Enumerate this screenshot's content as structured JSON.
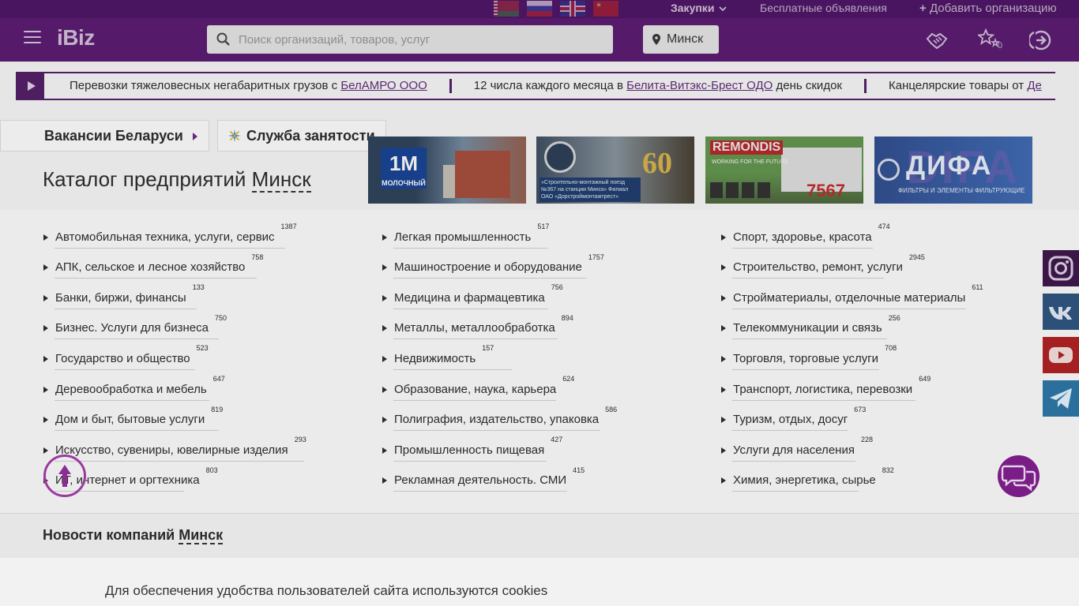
{
  "topbar": {
    "flags": [
      "by-flag",
      "ru-flag",
      "gb-flag",
      "cn-flag"
    ],
    "purchases": "Закупки",
    "free_ads": "Бесплатные объявления",
    "add_org": "Добавить организацию"
  },
  "header": {
    "logo": "iBiz",
    "search_placeholder": "Поиск организаций, товаров, услуг",
    "city": "Минск",
    "favorites_count": "0"
  },
  "ticker": {
    "items": [
      {
        "pre": "Перевозки тяжеловесных негабаритных грузов с ",
        "link": "БелАМРО ООО",
        "post": ""
      },
      {
        "pre": "12 числа каждого месяца в ",
        "link": "Белита-Витэкс-Брест ОДО",
        "post": " день скидок"
      },
      {
        "pre": "Канцелярские товары от ",
        "link": "Де",
        "post": ""
      }
    ]
  },
  "tabs": {
    "vacancies": "Вакансии Беларуси",
    "employment": "Служба занятости"
  },
  "catalog": {
    "title_prefix": "Каталог предприятий ",
    "title_city": "Минск",
    "columns": [
      [
        {
          "label": "Автомобильная техника, услуги, сервис",
          "count": "1387"
        },
        {
          "label": "АПК, сельское и лесное хозяйство",
          "count": "758"
        },
        {
          "label": "Банки, биржи, финансы",
          "count": "133"
        },
        {
          "label": "Бизнес. Услуги для бизнеса",
          "count": "750"
        },
        {
          "label": "Государство и общество",
          "count": "523"
        },
        {
          "label": "Деревообработка и мебель",
          "count": "647"
        },
        {
          "label": "Дом и быт, бытовые услуги",
          "count": "819"
        },
        {
          "label": "Искусство, сувениры, ювелирные изделия",
          "count": "293"
        },
        {
          "label": "ИТ, интернет и оргтехника",
          "count": "803"
        }
      ],
      [
        {
          "label": "Легкая промышленность",
          "count": "517"
        },
        {
          "label": "Машиностроение и оборудование",
          "count": "1757"
        },
        {
          "label": "Медицина и фармацевтика",
          "count": "756"
        },
        {
          "label": "Металлы, металлообработка",
          "count": "894"
        },
        {
          "label": "Недвижимость",
          "count": "157"
        },
        {
          "label": "Образование, наука, карьера",
          "count": "624"
        },
        {
          "label": "Полиграфия, издательство, упаковка",
          "count": "586"
        },
        {
          "label": "Промышленность пищевая",
          "count": "427"
        },
        {
          "label": "Рекламная деятельность. СМИ",
          "count": "415"
        }
      ],
      [
        {
          "label": "Спорт, здоровье, красота",
          "count": "474"
        },
        {
          "label": "Строительство, ремонт, услуги",
          "count": "2945"
        },
        {
          "label": "Стройматериалы, отделочные материалы",
          "count": "611"
        },
        {
          "label": "Телекоммуникации и связь",
          "count": "256"
        },
        {
          "label": "Торговля, торговые услуги",
          "count": "708"
        },
        {
          "label": "Транспорт, логистика, перевозки",
          "count": "649"
        },
        {
          "label": "Туризм, отдых, досуг",
          "count": "673"
        },
        {
          "label": "Услуги для населения",
          "count": "228"
        },
        {
          "label": "Химия, энергетика, сырье",
          "count": "832"
        }
      ]
    ]
  },
  "banners": {
    "b1_logo": "1M",
    "b1_sub": "МОЛОЧНЫЙ",
    "b2_text": "«Строительно-монтажный поезд №367 на станции Минск» Филиал ОАО «Дорстроймонтажтрест»",
    "b2_big": "60",
    "b3_title": "REMONDIS",
    "b3_sub": "WORKING FOR THE FUTURE",
    "b3_num": "7567",
    "b4_bg": "DIFA",
    "b4_title": "ДИФА",
    "b4_sub": "ФИЛЬТРЫ И ЭЛЕМЕНТЫ ФИЛЬТРУЮЩИЕ"
  },
  "news": {
    "title_prefix": "Новости компаний ",
    "title_city": "Минск"
  },
  "cookie": {
    "text": "Для обеспечения удобства пользователей сайта используются cookies"
  },
  "colors": {
    "brand": "#551a69",
    "topbar": "#4a1560",
    "link": "#5b2a72"
  }
}
